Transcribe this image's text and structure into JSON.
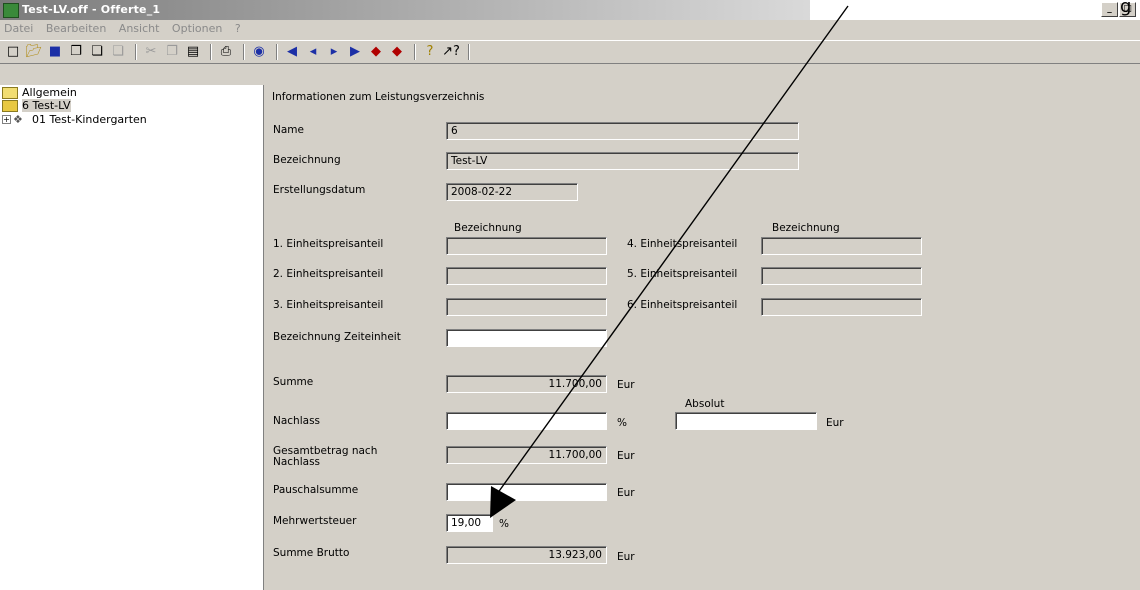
{
  "window": {
    "title": "Test-LV.off - Offerte_1",
    "controls": [
      "_",
      "□"
    ]
  },
  "menu": [
    "Datei",
    "Bearbeiten",
    "Ansicht",
    "Optionen",
    "?"
  ],
  "toolbar": {
    "icons": [
      "new-file-icon",
      "open-folder-icon",
      "save-icon",
      "copy-doc-icon",
      "paste-doc-icon",
      "doc-icon",
      "cut-icon",
      "copy-icon",
      "paste-icon",
      "print-icon",
      "globe-icon",
      "first-icon",
      "prev-icon",
      "next-icon",
      "last-icon",
      "red-up-icon",
      "red-down-icon",
      "help-icon",
      "context-help-icon"
    ]
  },
  "tree": {
    "items": [
      {
        "label": "Allgemein"
      },
      {
        "label": "6 Test-LV"
      },
      {
        "label": "01  Test-Kindergarten",
        "expander": "+"
      }
    ]
  },
  "form": {
    "heading": "Informationen zum Leistungsverzeichnis",
    "name_label": "Name",
    "name_value": "6",
    "bezeichnung_label": "Bezeichnung",
    "bezeichnung_value": "Test-LV",
    "datum_label": "Erstellungsdatum",
    "datum_value": "2008-02-22",
    "col_header_left": "Bezeichnung",
    "col_header_right": "Bezeichnung",
    "anteile_left": [
      "1. Einheitspreisanteil",
      "2. Einheitspreisanteil",
      "3. Einheitspreisanteil"
    ],
    "anteile_right": [
      "4. Einheitspreisanteil",
      "5. Einheitspreisanteil",
      "6. Einheitspreisanteil"
    ],
    "zeiteinheit_label": "Bezeichnung Zeiteinheit",
    "summe_label": "Summe",
    "summe_value": "11.700,00",
    "nachlass_label": "Nachlass",
    "absolut_label": "Absolut",
    "gesamt_label_1": "Gesamtbetrag nach",
    "gesamt_label_2": "Nachlass",
    "gesamt_value": "11.700,00",
    "pauschal_label": "Pauschalsumme",
    "mwst_label": "Mehrwertsteuer",
    "mwst_value": "19,00",
    "brutto_label": "Summe Brutto",
    "brutto_value": "13.923,00",
    "unit_eur": "Eur",
    "unit_percent": "%"
  },
  "annotation": {
    "corner_text": "g"
  }
}
